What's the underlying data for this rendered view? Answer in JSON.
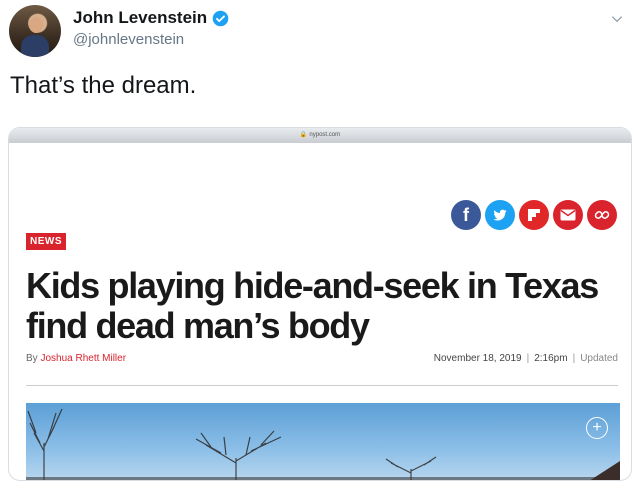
{
  "tweet": {
    "display_name": "John Levenstein",
    "handle": "@johnlevenstein",
    "text": "That’s the dream."
  },
  "article": {
    "site_url": "nypost.com",
    "badge": "NEWS",
    "headline": "Kids playing hide-and-seek in Texas find dead man’s body",
    "byline_prefix": "By",
    "author": "Joshua Rhett Miller",
    "date": "November 18, 2019",
    "time": "2:16pm",
    "updated_label": "Updated",
    "share_icons": [
      {
        "name": "facebook-icon",
        "color": "#3b5998",
        "glyph": "f"
      },
      {
        "name": "twitter-icon",
        "color": "#1da1f2",
        "glyph": "t"
      },
      {
        "name": "flipboard-icon",
        "color": "#e12828",
        "glyph": "F"
      },
      {
        "name": "email-icon",
        "color": "#d9232d",
        "glyph": "✉"
      },
      {
        "name": "link-icon",
        "color": "#d9232d",
        "glyph": "⚭"
      }
    ]
  },
  "colors": {
    "brand_red": "#d9232d",
    "verified_blue": "#1da1f2"
  }
}
